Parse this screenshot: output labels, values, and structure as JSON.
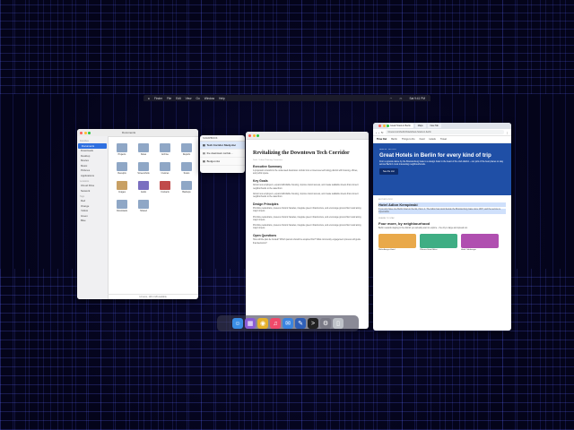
{
  "menubar": {
    "items": [
      "Finder",
      "File",
      "Edit",
      "View",
      "Go",
      "Window",
      "Help"
    ],
    "clock": "Sat 9:41 PM"
  },
  "finder": {
    "title": "Documents",
    "sidebar": {
      "favorites_head": "Favorites",
      "items": [
        "Documents",
        "Downloads",
        "Desktop",
        "Movies",
        "Music",
        "Pictures",
        "Applications"
      ],
      "locations_head": "Locations",
      "locations": [
        "iCloud Drive",
        "Network"
      ],
      "tags_head": "Tags",
      "tags": [
        "Red",
        "Orange",
        "Yellow",
        "Green",
        "Blue"
      ]
    },
    "files": [
      {
        "name": "Projects",
        "color": "#8fa7c6"
      },
      {
        "name": "Notes",
        "color": "#8fa7c6"
      },
      {
        "name": "Archive",
        "color": "#8fa7c6"
      },
      {
        "name": "Reports",
        "color": "#8fa7c6"
      },
      {
        "name": "Receipts",
        "color": "#8fa7c6"
      },
      {
        "name": "Screenshots",
        "color": "#8fa7c6"
      },
      {
        "name": "Invoices",
        "color": "#8fa7c6"
      },
      {
        "name": "Scans",
        "color": "#8fa7c6"
      },
      {
        "name": "Images",
        "color": "#c8a064"
      },
      {
        "name": "Audio",
        "color": "#7a6fc0"
      },
      {
        "name": "Contacts",
        "color": "#c04a4a"
      },
      {
        "name": "Backups",
        "color": "#8fa7c6"
      },
      {
        "name": "Downloads",
        "color": "#8fa7c6"
      },
      {
        "name": "Shared",
        "color": "#8fa7c6"
      }
    ],
    "status": "14 items, 128.4 GB available"
  },
  "notes": {
    "header": "SCRAPBOOK",
    "items": [
      "Tech Corridor Study.doc",
      "the downtown corrido...",
      "Budget.xlsx"
    ]
  },
  "doc": {
    "title": "Revitalizing the Downtown Tech Corridor",
    "meta": "Draft · Urban Planning Committee",
    "sections": [
      {
        "heading": "Executive Summary",
        "text": "A proposal to transform the underused downtown corridor into a mixed-use technology district with housing, offices, and public space."
      },
      {
        "heading": "Key Goals",
        "text": "Attract new employers, expand affordable housing, improve transit access, and create walkable streets that connect neighborhoods to the waterfront."
      },
      {
        "heading": "Design Principles",
        "text": "Prioritize pedestrians, preserve historic facades, integrate green infrastructure, and encourage ground-floor retail along major streets."
      },
      {
        "heading": "Open Questions",
        "text": "How will the plan be funded? Which parcels should be acquired first? What community engagement process will guide final decisions?"
      }
    ]
  },
  "browser": {
    "tabs": [
      "Great Hotels in Berlin",
      "Maps",
      "New Tab"
    ],
    "url": "timeout.com/berlin/hotels/best-hotels-in-berlin",
    "site_nav": [
      "Time Out",
      "Berlin",
      "Things to Do",
      "Food",
      "Hotels",
      "Travel"
    ],
    "hero": {
      "kicker": "BERLIN · HOTELS",
      "title": "Great Hotels in Berlin for every kind of trip",
      "text": "From a grande dame by the Brandenburg Gate to a design hotel in the heart of the club district – our pick of the best places to stay across Berlin's most interesting neighbourhoods.",
      "button": "See the List"
    },
    "article": {
      "kicker": "EDITOR'S PICK",
      "title": "Hotel Adlon Kempinski",
      "text": "If you only have one Berlin hotel on the list, this is it. The Adlon has stood beside the Brandenburg Gate since 1907, and the service is impeccable.",
      "section_kicker": "WHERE TO STAY",
      "section_title": "Four more, by neighbourhood",
      "section_text": "Berlin rewards staying in the district you actually want to explore – the city is large and spread out.",
      "cards": [
        {
          "label": "Michelberger Hotel",
          "color": "#e9a94a"
        },
        {
          "label": "25hours Hotel Bikini",
          "color": "#3fae84"
        },
        {
          "label": "Hotel Oderberger",
          "color": "#b04fb0"
        }
      ]
    }
  },
  "dock": {
    "apps": [
      {
        "name": "finder",
        "glyph": "☺",
        "color": "#3a8ee6"
      },
      {
        "name": "launchpad",
        "glyph": "▦",
        "color": "#8a5cd6"
      },
      {
        "name": "chrome",
        "glyph": "◉",
        "color": "#e5b12b"
      },
      {
        "name": "music",
        "glyph": "♫",
        "color": "#f04a6a"
      },
      {
        "name": "mail",
        "glyph": "✉",
        "color": "#3a84e0"
      },
      {
        "name": "messages",
        "glyph": "✎",
        "color": "#2f5fb8"
      },
      {
        "name": "terminal",
        "glyph": ">",
        "color": "#222"
      },
      {
        "name": "settings",
        "glyph": "⚙",
        "color": "#7a7a86"
      },
      {
        "name": "trash",
        "glyph": "▯",
        "color": "#bfc3c9"
      }
    ]
  }
}
